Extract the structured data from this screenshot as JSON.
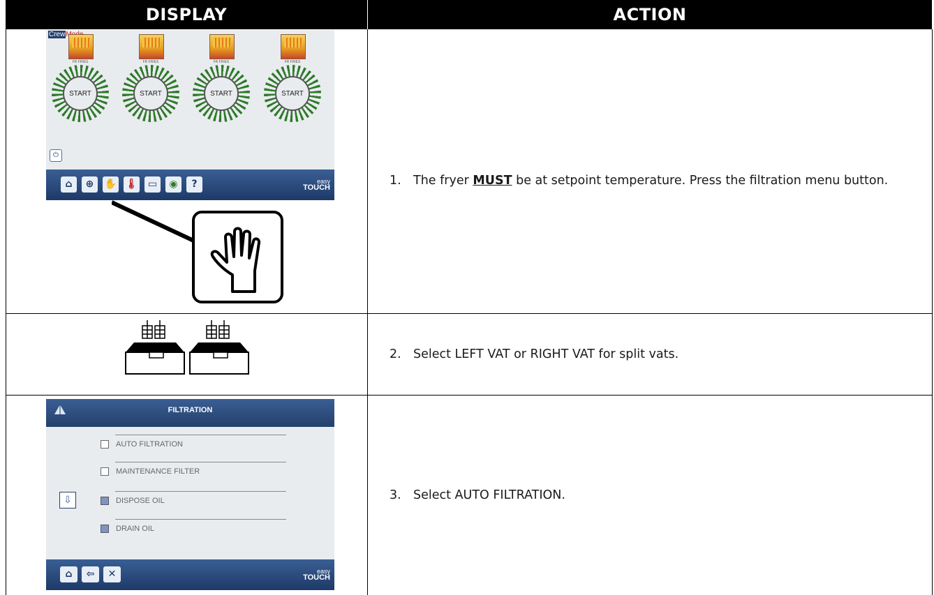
{
  "header": {
    "display": "DISPLAY",
    "action": "ACTION"
  },
  "screen1": {
    "mode_crew": "Crew",
    "mode_label": "Mode",
    "product_labels": [
      "FR FRIES",
      "FR FRIES",
      "FR FRIES",
      "FR FRIES"
    ],
    "start_label": "START",
    "help_icon": "?",
    "brand_easy": "easy",
    "brand_touch": "TOUCH",
    "toolbar_icons": [
      "home-icon",
      "globe-icon",
      "filter-hand-icon",
      "thermometer-icon",
      "book-icon",
      "leaf-icon",
      "help-icon"
    ]
  },
  "screen3": {
    "title": "FILTRATION",
    "options": [
      {
        "label": "AUTO FILTRATION",
        "enabled": true
      },
      {
        "label": "MAINTENANCE FILTER",
        "enabled": true
      },
      {
        "label": "DISPOSE OIL",
        "enabled": false
      },
      {
        "label": "DRAIN OIL",
        "enabled": false
      }
    ],
    "brand_easy": "easy",
    "brand_touch": "TOUCH",
    "toolbar_icons": [
      "home-icon",
      "back-arrow-icon",
      "tools-icon"
    ]
  },
  "steps": [
    {
      "num": "1.",
      "text_before": "The fryer ",
      "emphasis": "MUST",
      "text_after": " be at setpoint temperature. Press the filtration menu button."
    },
    {
      "num": "2.",
      "text": "Select LEFT VAT or RIGHT VAT for split vats."
    },
    {
      "num": "3.",
      "text": "Select AUTO FILTRATION."
    }
  ]
}
